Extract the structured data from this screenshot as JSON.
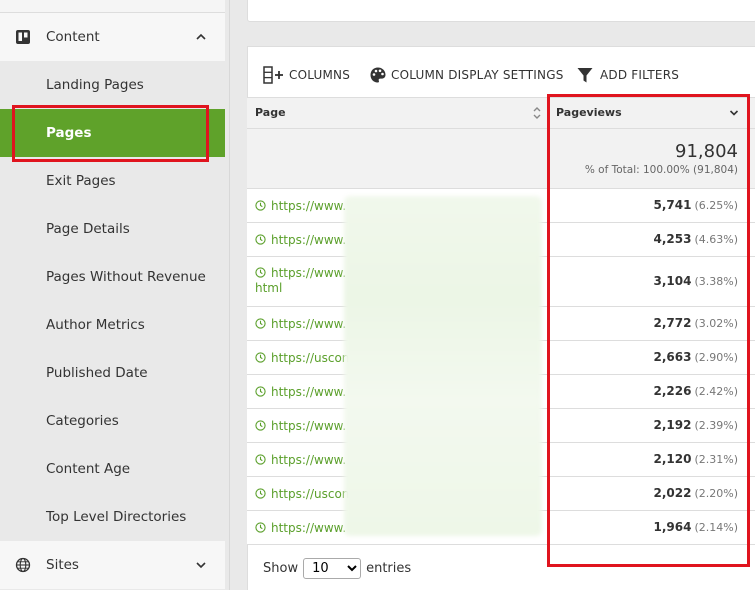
{
  "sidebar": {
    "content_section": {
      "label": "Content",
      "icon": "trello-board-icon",
      "chevron": "chevron-up-icon"
    },
    "items": [
      {
        "label": "Landing Pages",
        "active": false
      },
      {
        "label": "Pages",
        "active": true
      },
      {
        "label": "Exit Pages",
        "active": false
      },
      {
        "label": "Page Details",
        "active": false
      },
      {
        "label": "Pages Without Revenue",
        "active": false
      },
      {
        "label": "Author Metrics",
        "active": false
      },
      {
        "label": "Published Date",
        "active": false
      },
      {
        "label": "Categories",
        "active": false
      },
      {
        "label": "Content Age",
        "active": false
      },
      {
        "label": "Top Level Directories",
        "active": false
      }
    ],
    "sites_section": {
      "label": "Sites",
      "icon": "globe-icon",
      "chevron": "chevron-down-icon"
    }
  },
  "toolbar": {
    "columns_label": "COLUMNS",
    "display_settings_label": "COLUMN DISPLAY SETTINGS",
    "filters_label": "ADD FILTERS"
  },
  "table": {
    "headers": {
      "page": "Page",
      "pageviews": "Pageviews"
    },
    "totals": {
      "value": "91,804",
      "subtitle": "% of Total: 100.00% (91,804)"
    },
    "rows": [
      {
        "url": "https://www.",
        "url_cont": "",
        "value": "5,741",
        "pct": "(6.25%)"
      },
      {
        "url": "https://www.",
        "url_cont": "",
        "value": "4,253",
        "pct": "(4.63%)"
      },
      {
        "url": "https://www.",
        "url_cont": "html",
        "value": "3,104",
        "pct": "(3.38%)"
      },
      {
        "url": "https://www.",
        "url_cont": "",
        "value": "2,772",
        "pct": "(3.02%)"
      },
      {
        "url": "https://uscon",
        "url_cont": "",
        "value": "2,663",
        "pct": "(2.90%)"
      },
      {
        "url": "https://www.",
        "url_cont": "",
        "value": "2,226",
        "pct": "(2.42%)"
      },
      {
        "url": "https://www.",
        "url_cont": "",
        "value": "2,192",
        "pct": "(2.39%)"
      },
      {
        "url": "https://www.",
        "url_cont": "",
        "value": "2,120",
        "pct": "(2.31%)"
      },
      {
        "url": "https://uscon",
        "url_cont": "",
        "value": "2,022",
        "pct": "(2.20%)"
      },
      {
        "url": "https://www.",
        "url_cont": "",
        "value": "1,964",
        "pct": "(2.14%)"
      }
    ]
  },
  "footer": {
    "show_label": "Show",
    "entries_value": "10",
    "entries_label": "entries"
  },
  "colors": {
    "accent_green": "#5fa22a",
    "link_green": "#5a9f2a",
    "highlight_red": "#e0141e"
  }
}
